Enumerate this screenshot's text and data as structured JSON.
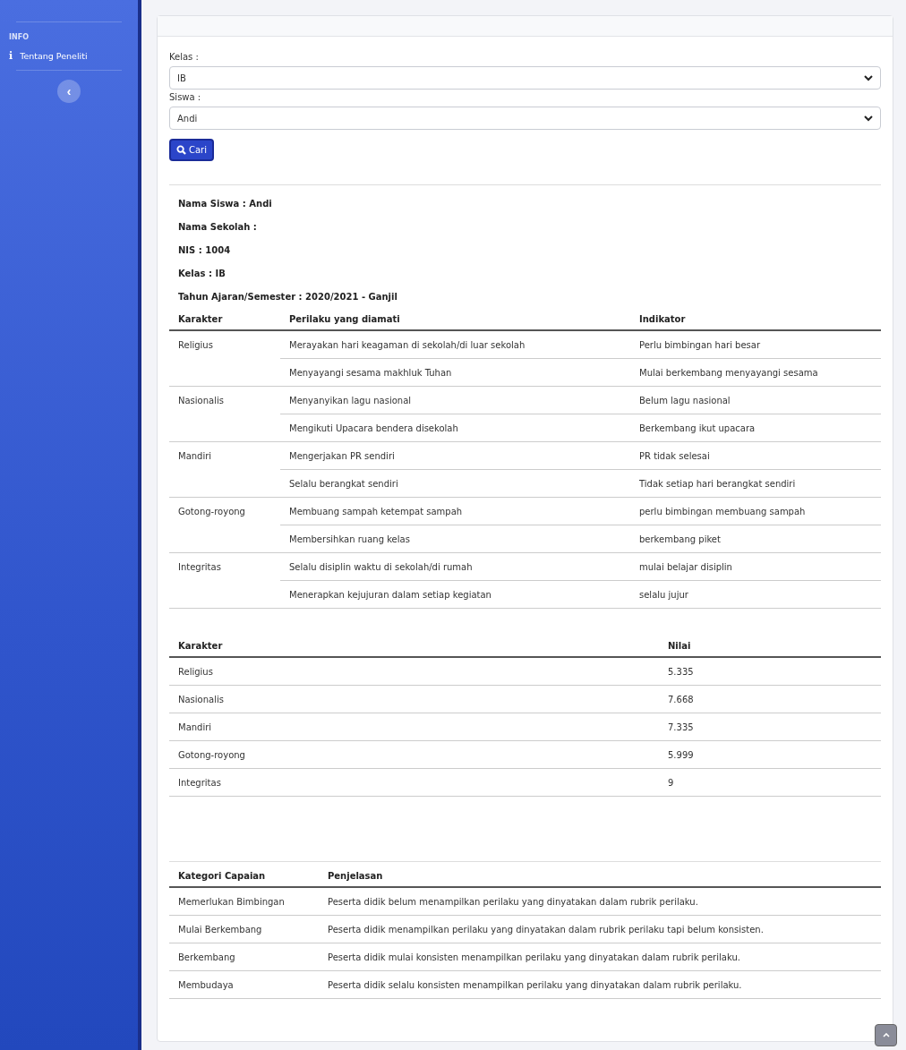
{
  "sidebar": {
    "heading": "INFO",
    "items": [
      {
        "label": "Tentang Peneliti",
        "icon": "i"
      }
    ],
    "toggle": "‹"
  },
  "form": {
    "fields": [
      {
        "label": "Kelas :",
        "value": "IB"
      },
      {
        "label": "Siswa :",
        "value": "Andi"
      }
    ],
    "button": "Cari"
  },
  "info": [
    "Nama Siswa : Andi",
    "Nama Sekolah :",
    "NIS : 1004",
    "Kelas : IB",
    "Tahun Ajaran/Semester : 2020/2021 - Ganjil"
  ],
  "behavior_table": {
    "columns": [
      "Karakter",
      "Perilaku yang diamati",
      "Indikator"
    ],
    "groups": [
      {
        "karakter": "Religius",
        "rows": [
          {
            "perilaku": "Merayakan hari keagaman di sekolah/di luar sekolah",
            "indikator": "Perlu bimbingan hari besar"
          },
          {
            "perilaku": "Menyayangi sesama makhluk Tuhan",
            "indikator": "Mulai berkembang menyayangi sesama"
          }
        ]
      },
      {
        "karakter": "Nasionalis",
        "rows": [
          {
            "perilaku": "Menyanyikan lagu nasional",
            "indikator": "Belum lagu nasional"
          },
          {
            "perilaku": "Mengikuti Upacara bendera disekolah",
            "indikator": "Berkembang ikut upacara"
          }
        ]
      },
      {
        "karakter": "Mandiri",
        "rows": [
          {
            "perilaku": "Mengerjakan PR sendiri",
            "indikator": "PR tidak selesai"
          },
          {
            "perilaku": "Selalu berangkat sendiri",
            "indikator": "Tidak setiap hari berangkat sendiri"
          }
        ]
      },
      {
        "karakter": "Gotong-royong",
        "rows": [
          {
            "perilaku": "Membuang sampah ketempat sampah",
            "indikator": "perlu bimbingan membuang sampah"
          },
          {
            "perilaku": "Membersihkan ruang kelas",
            "indikator": "berkembang piket"
          }
        ]
      },
      {
        "karakter": "Integritas",
        "rows": [
          {
            "perilaku": "Selalu disiplin waktu di sekolah/di rumah",
            "indikator": "mulai belajar disiplin"
          },
          {
            "perilaku": "Menerapkan kejujuran dalam setiap kegiatan",
            "indikator": "selalu jujur"
          }
        ]
      }
    ]
  },
  "score_table": {
    "columns": [
      "Karakter",
      "Nilai"
    ],
    "rows": [
      [
        "Religius",
        "5.335"
      ],
      [
        "Nasionalis",
        "7.668"
      ],
      [
        "Mandiri",
        "7.335"
      ],
      [
        "Gotong-royong",
        "5.999"
      ],
      [
        "Integritas",
        "9"
      ]
    ]
  },
  "category_table": {
    "columns": [
      "Kategori Capaian",
      "Penjelasan"
    ],
    "rows": [
      [
        "Memerlukan Bimbingan",
        "Peserta didik belum menampilkan perilaku yang dinyatakan dalam rubrik perilaku."
      ],
      [
        "Mulai Berkembang",
        "Peserta didik menampilkan perilaku yang dinyatakan dalam rubrik perilaku tapi belum konsisten."
      ],
      [
        "Berkembang",
        "Peserta didik mulai konsisten menampilkan perilaku yang dinyatakan dalam rubrik perilaku."
      ],
      [
        "Membudaya",
        "Peserta didik selalu konsisten menampilkan perilaku yang dinyatakan dalam rubrik perilaku."
      ]
    ]
  }
}
